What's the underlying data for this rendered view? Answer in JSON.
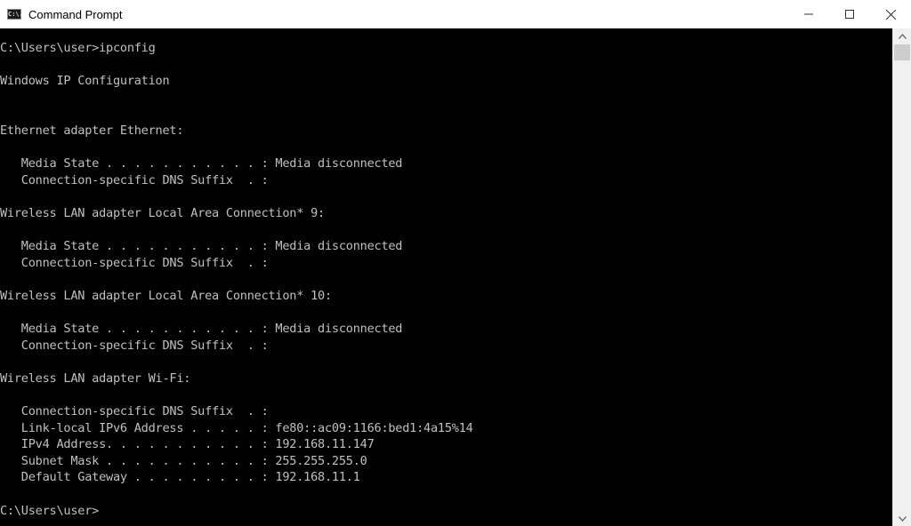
{
  "window": {
    "title": "Command Prompt",
    "icon": "cmd-icon",
    "icon_text": "C:\\.",
    "controls": {
      "minimize": "minimize-icon",
      "maximize": "maximize-icon",
      "close": "close-icon"
    }
  },
  "console": {
    "lines": [
      "C:\\Users\\user>ipconfig",
      "",
      "Windows IP Configuration",
      "",
      "",
      "Ethernet adapter Ethernet:",
      "",
      "   Media State . . . . . . . . . . . : Media disconnected",
      "   Connection-specific DNS Suffix  . :",
      "",
      "Wireless LAN adapter Local Area Connection* 9:",
      "",
      "   Media State . . . . . . . . . . . : Media disconnected",
      "   Connection-specific DNS Suffix  . :",
      "",
      "Wireless LAN adapter Local Area Connection* 10:",
      "",
      "   Media State . . . . . . . . . . . : Media disconnected",
      "   Connection-specific DNS Suffix  . :",
      "",
      "Wireless LAN adapter Wi-Fi:",
      "",
      "   Connection-specific DNS Suffix  . :",
      "   Link-local IPv6 Address . . . . . : fe80::ac09:1166:bed1:4a15%14",
      "   IPv4 Address. . . . . . . . . . . : 192.168.11.147",
      "   Subnet Mask . . . . . . . . . . . : 255.255.255.0",
      "   Default Gateway . . . . . . . . . : 192.168.11.1",
      "",
      "C:\\Users\\user>"
    ]
  },
  "scrollbar": {
    "up_icon": "chevron-up-icon",
    "down_icon": "chevron-down-icon",
    "position": 0
  }
}
